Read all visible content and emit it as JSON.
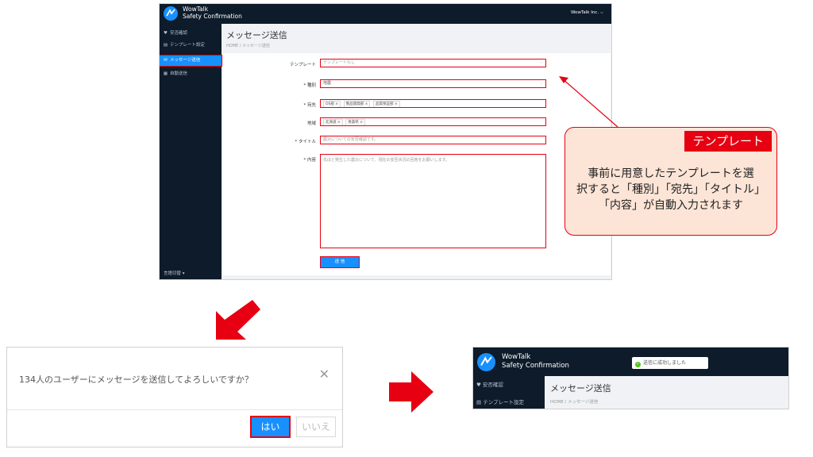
{
  "app": {
    "brand_line1": "WowTalk",
    "brand_line2": "Safety Confirmation",
    "company": "WowTalk Inc. ⌵",
    "sidebar": [
      {
        "label": "安否確認",
        "icon": "♥"
      },
      {
        "label": "テンプレート設定",
        "icon": "▤"
      },
      {
        "label": "メッセージ送信",
        "icon": "✉"
      },
      {
        "label": "自動送信",
        "icon": "▦"
      }
    ],
    "language": "言語切替 ▾",
    "page_title": "メッセージ送信",
    "breadcrumb": "HOME / メッセージ送信",
    "form": {
      "template_label": "テンプレート",
      "template_value": "テンプレートなし",
      "type_label": "* 種別",
      "type_value": "地震",
      "dest_label": "* 宛先",
      "dest_tags": [
        "OS部 ×",
        "製品開発部 ×",
        "品質保証部 ×"
      ],
      "region_label": "地域",
      "region_tags": [
        "北海道 ×",
        "青森県 ×"
      ],
      "title_label": "* タイトル",
      "title_value": "震災についての安否確認です。",
      "body_label": "* 内容",
      "body_value": "先ほど発生した震災について、現在の安否状況の回答をお願いします。",
      "submit_label": "送 信"
    }
  },
  "callout": {
    "tag": "テンプレート",
    "text_line1": "事前に用意したテンプレートを選",
    "text_line2": "択すると「種別」「宛先」「タイトル」",
    "text_line3": "「内容」が自動入力されます"
  },
  "dialog": {
    "message": "134人のユーザーにメッセージを送信してよろしいですか？",
    "close": "✕",
    "yes": "はい",
    "no": "いいえ"
  },
  "result": {
    "brand_line1": "WowTalk",
    "brand_line2": "Safety Confirmation",
    "toast": "送信に成功しました",
    "toast_icon": "✓",
    "sidebar": [
      "♥  安否確認",
      "▤  テンプレート設定"
    ],
    "page_title": "メッセージ送信",
    "breadcrumb": "HOME / メッセージ送信"
  },
  "colors": {
    "accent": "#1890ff",
    "highlight": "#e60012",
    "navy": "#0d1b2a",
    "callout_bg": "#fce4d6"
  }
}
